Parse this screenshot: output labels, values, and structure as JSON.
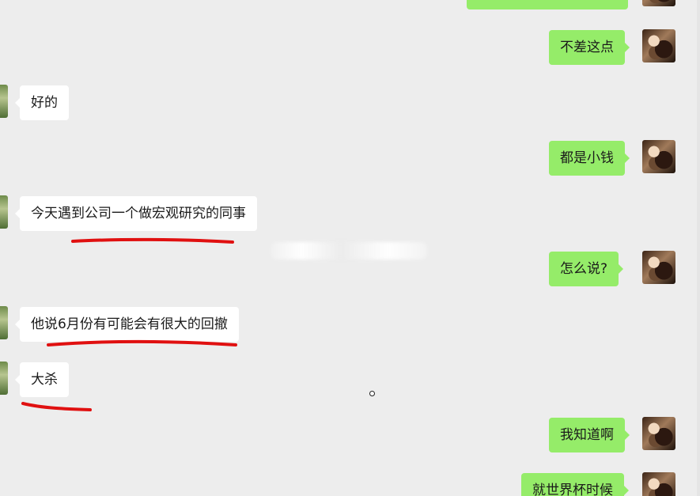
{
  "messages": {
    "top_partial": "",
    "m1": "不差这点",
    "m2": "好的",
    "m3": "都是小钱",
    "m4": "今天遇到公司一个做宏观研究的同事",
    "m5": "怎么说?",
    "m6": "他说6月份有可能会有很大的回撤",
    "m7": "大杀",
    "m8": "我知道啊",
    "m9": "就世界杯时候"
  },
  "colors": {
    "outgoing_bubble": "#95ec69",
    "incoming_bubble": "#ffffff",
    "background": "#ededed",
    "annotation": "#e01010"
  }
}
